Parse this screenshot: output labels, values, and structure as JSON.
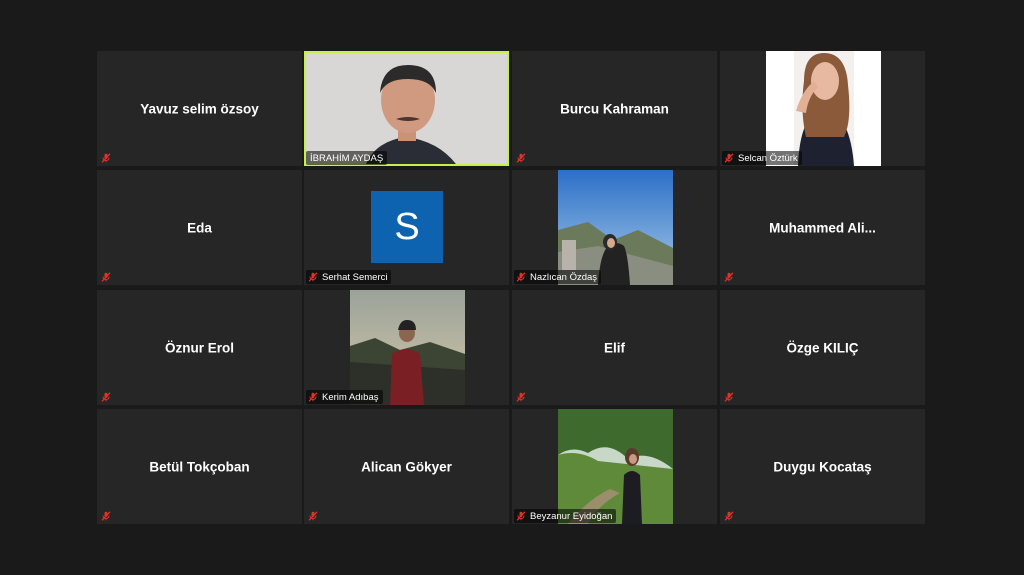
{
  "participants": [
    {
      "name": "Yavuz selim özsoy",
      "muted": true
    },
    {
      "name": "İBRAHİM AYDAŞ",
      "muted": false,
      "active": true
    },
    {
      "name": "Burcu Kahraman",
      "muted": true
    },
    {
      "name": "Selcan Öztürk",
      "muted": true
    },
    {
      "name": "Eda",
      "muted": true
    },
    {
      "name": "Serhat Semerci",
      "muted": true,
      "avatar_letter": "S",
      "avatar_color": "#0e63b0"
    },
    {
      "name": "Nazlıcan Özdaş",
      "muted": true
    },
    {
      "name": "Muhammed  Ali...",
      "muted": true
    },
    {
      "name": "Öznur Erol",
      "muted": true
    },
    {
      "name": "Kerim Adıbaş",
      "muted": true
    },
    {
      "name": "Elif",
      "muted": true
    },
    {
      "name": "Özge KILIÇ",
      "muted": true
    },
    {
      "name": "Betül Tokçoban",
      "muted": true
    },
    {
      "name": "Alican Gökyer",
      "muted": true
    },
    {
      "name": "Beyzanur Eyidoğan",
      "muted": true
    },
    {
      "name": "Duygu Kocataş",
      "muted": true
    }
  ],
  "colors": {
    "active_speaker": "#c8f04a",
    "muted_icon": "#e0322a",
    "tile_bg": "#262626",
    "page_bg": "#1a1a1a"
  },
  "icons": {
    "muted": "mic-muted-icon"
  }
}
